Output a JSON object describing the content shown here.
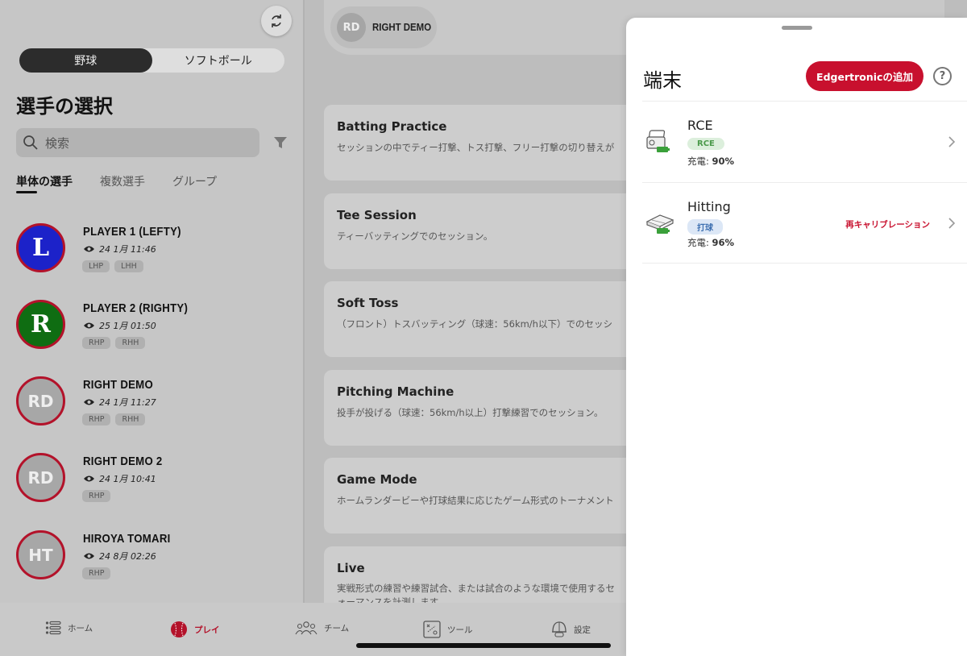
{
  "left": {
    "sport_tabs": [
      "野球",
      "ソフトボール"
    ],
    "title": "選手の選択",
    "search_placeholder": "検索",
    "sub_tabs": [
      "単体の選手",
      "複数選手",
      "グループ"
    ],
    "players": [
      {
        "avatar": "L",
        "avatar_color": "#1c22c9",
        "name": "PLAYER 1 (LEFTY)",
        "date": "24 1月 11:46",
        "tags": [
          "LHP",
          "LHH"
        ]
      },
      {
        "avatar": "R",
        "avatar_color": "#0f6d12",
        "name": "PLAYER 2 (RIGHTY)",
        "date": "25 1月 01:50",
        "tags": [
          "RHP",
          "RHH"
        ]
      },
      {
        "avatar": "RD",
        "avatar_color": "#a7a7a7",
        "name": "RIGHT DEMO",
        "date": "24 1月 11:27",
        "tags": [
          "RHP",
          "RHH"
        ]
      },
      {
        "avatar": "RD",
        "avatar_color": "#a7a7a7",
        "name": "RIGHT DEMO 2",
        "date": "24 1月 10:41",
        "tags": [
          "RHP"
        ]
      },
      {
        "avatar": "HT",
        "avatar_color": "#a7a7a7",
        "name": "HIROYA TOMARI",
        "date": "24 8月 02:26",
        "tags": [
          "RHP"
        ]
      }
    ]
  },
  "main": {
    "selected_player": {
      "avatar": "RD",
      "name": "RIGHT DEMO"
    },
    "sessions": [
      {
        "title": "Batting Practice",
        "desc": "セッションの中でティー打撃、トス打撃、フリー打撃の切り替えが"
      },
      {
        "title": "Tee Session",
        "desc": "ティーバッティングでのセッション。"
      },
      {
        "title": "Soft Toss",
        "desc": "（フロント）トスバッティング（球速：56km/h以下）でのセッシ"
      },
      {
        "title": "Pitching Machine",
        "desc": "投手が投げる（球速：56km/h以上）打撃練習でのセッション。"
      },
      {
        "title": "Game Mode",
        "desc": "ホームランダービーや打球結果に応じたゲーム形式のトーナメント"
      },
      {
        "title": "Live",
        "desc": "実戦形式の練習や練習試合、または試合のような環境で使用するセ",
        "desc2": "ォーマンスを計測します。"
      }
    ]
  },
  "nav": {
    "items": [
      {
        "label": "ホーム",
        "icon": "list-icon"
      },
      {
        "label": "プレイ",
        "icon": "baseball-icon"
      },
      {
        "label": "チーム",
        "icon": "team-icon"
      },
      {
        "label": "ツール",
        "icon": "tactics-icon"
      },
      {
        "label": "設定",
        "icon": "helmet-icon"
      }
    ],
    "active": "プレイ"
  },
  "sheet": {
    "title": "端末",
    "add_button": "Edgertronicの追加",
    "help": "?",
    "devices": [
      {
        "name": "RCE",
        "badge": "RCE",
        "charge_label": "充電:",
        "charge_value": "90%",
        "action": ""
      },
      {
        "name": "Hitting",
        "badge": "打球",
        "charge_label": "充電:",
        "charge_value": "96%",
        "action": "再キャリブレーション"
      }
    ]
  },
  "colors": {
    "accent": "#c8102e",
    "badge_green": "#4b9a4b",
    "badge_blue": "#3d6fb0"
  }
}
